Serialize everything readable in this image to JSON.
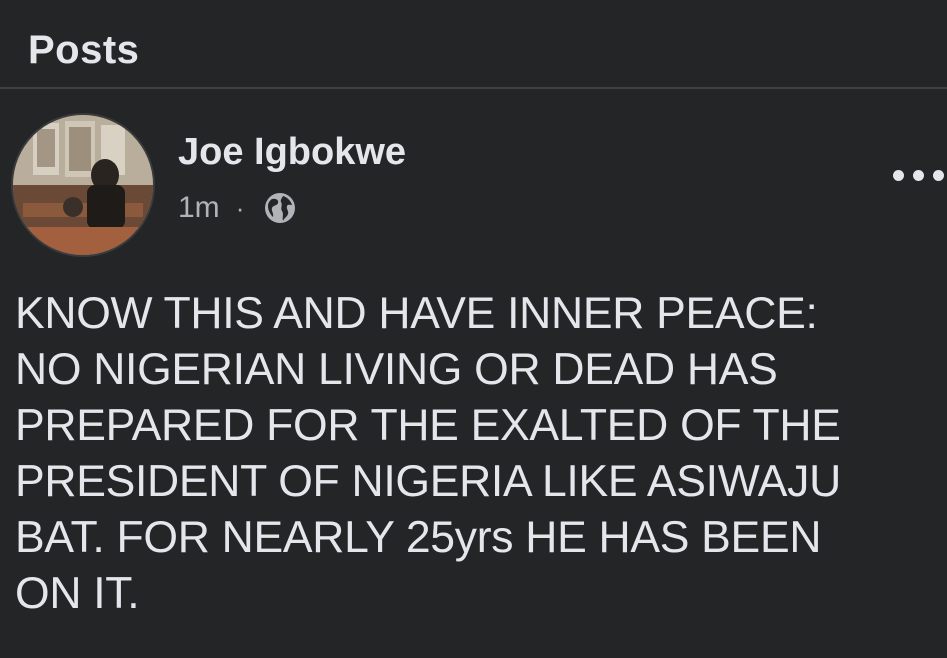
{
  "section": {
    "title": "Posts"
  },
  "post": {
    "author": "Joe Igbokwe",
    "timestamp": "1m",
    "separator": "·",
    "privacy_icon": "globe-icon",
    "more_icon": "more-options-icon",
    "text": "KNOW THIS AND HAVE INNER PEACE:\nNO NIGERIAN LIVING OR DEAD HAS\nPREPARED FOR THE EXALTED OF THE\nPRESIDENT OF NIGERIA LIKE ASIWAJU\nBAT. FOR NEARLY 25yrs HE HAS BEEN\nON IT."
  },
  "colors": {
    "background": "#242526",
    "primary_text": "#e4e6eb",
    "secondary_text": "#b0b3b8",
    "divider": "#3e4042"
  }
}
